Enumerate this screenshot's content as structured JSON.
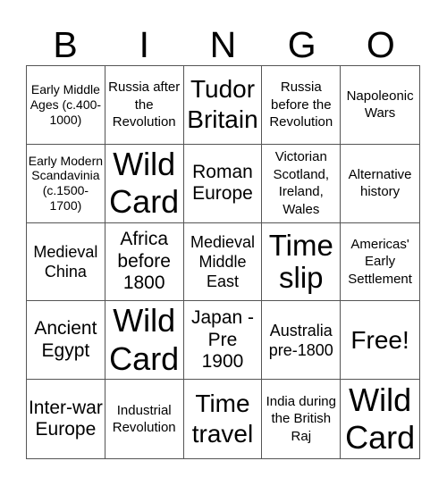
{
  "header": {
    "letters": [
      "B",
      "I",
      "N",
      "G",
      "O"
    ]
  },
  "cells": [
    {
      "text": "Early Middle Ages (c.400-1000)",
      "size": "s1"
    },
    {
      "text": "Russia after the Revolution",
      "size": "s2"
    },
    {
      "text": "Tudor Britain",
      "size": "s5"
    },
    {
      "text": "Russia before the Revolution",
      "size": "s2"
    },
    {
      "text": "Napoleonic Wars",
      "size": "s2"
    },
    {
      "text": "Early Modern Scandavinia (c.1500-1700)",
      "size": "s1"
    },
    {
      "text": "Wild Card",
      "size": "s6"
    },
    {
      "text": "Roman Europe",
      "size": "s4"
    },
    {
      "text": "Victorian Scotland, Ireland, Wales",
      "size": "s2"
    },
    {
      "text": "Alternative history",
      "size": "s2"
    },
    {
      "text": "Medieval China",
      "size": "s3"
    },
    {
      "text": "Africa before 1800",
      "size": "s4"
    },
    {
      "text": "Medieval Middle East",
      "size": "s3"
    },
    {
      "text": "Time slip",
      "size": "s7"
    },
    {
      "text": "Americas' Early Settlement",
      "size": "s2"
    },
    {
      "text": "Ancient Egypt",
      "size": "s4"
    },
    {
      "text": "Wild Card",
      "size": "s6"
    },
    {
      "text": "Japan - Pre 1900",
      "size": "s4"
    },
    {
      "text": "Australia pre-1800",
      "size": "s3"
    },
    {
      "text": "Free!",
      "size": "s5"
    },
    {
      "text": "Inter-war Europe",
      "size": "s4"
    },
    {
      "text": "Industrial Revolution",
      "size": "s2"
    },
    {
      "text": "Time travel",
      "size": "s5"
    },
    {
      "text": "India during the British Raj",
      "size": "s2"
    },
    {
      "text": "Wild Card",
      "size": "s6"
    }
  ]
}
